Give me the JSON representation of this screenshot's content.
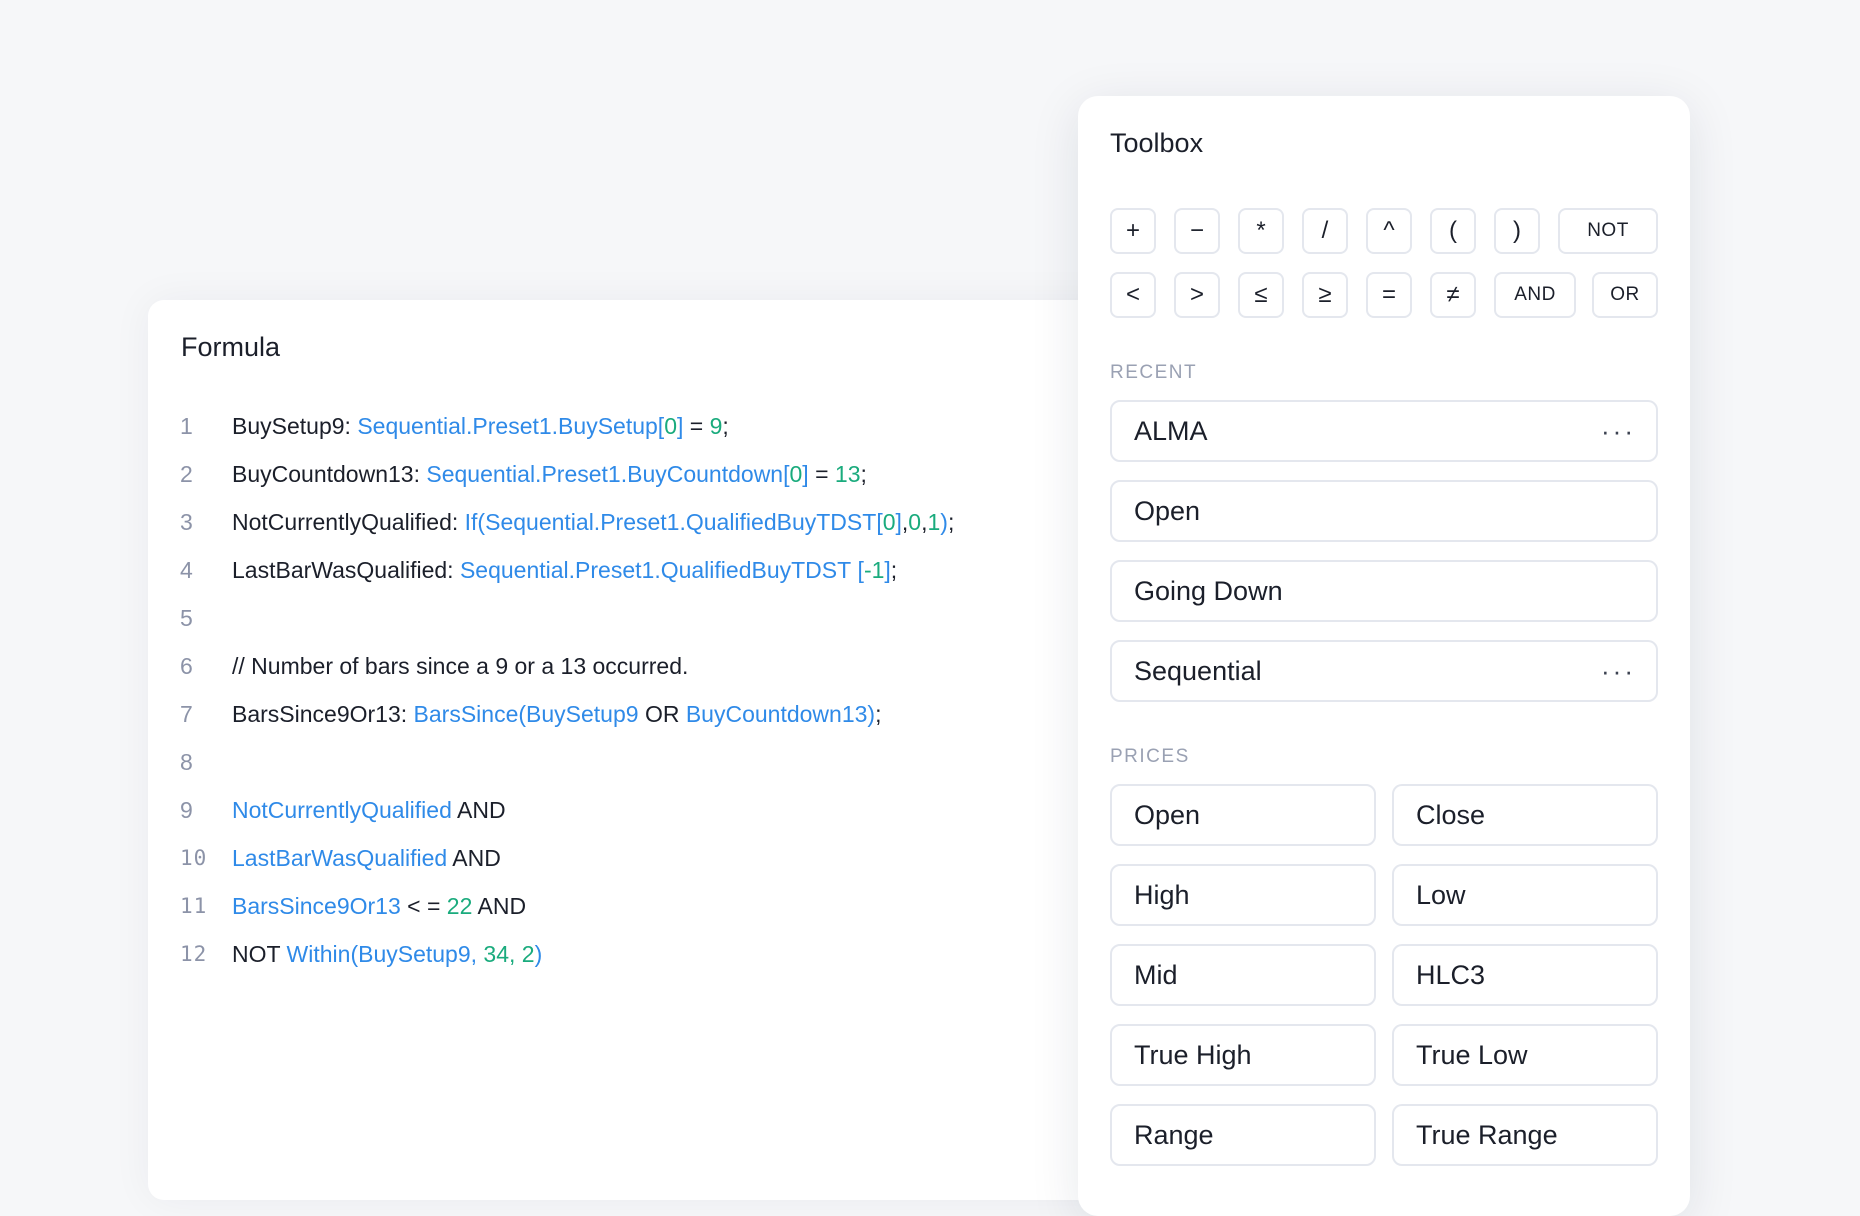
{
  "formula": {
    "title": "Formula",
    "lines": [
      {
        "num": "1",
        "tokens": [
          {
            "t": "BuySetup9: ",
            "c": "p"
          },
          {
            "t": "Sequential.Preset1.BuySetup",
            "c": "b"
          },
          {
            "t": "[",
            "c": "b"
          },
          {
            "t": "0",
            "c": "n"
          },
          {
            "t": "]",
            "c": "b"
          },
          {
            "t": " = ",
            "c": "p"
          },
          {
            "t": "9",
            "c": "n"
          },
          {
            "t": ";",
            "c": "p"
          }
        ]
      },
      {
        "num": "2",
        "tokens": [
          {
            "t": "BuyCountdown13: ",
            "c": "p"
          },
          {
            "t": "Sequential.Preset1.BuyCountdown",
            "c": "b"
          },
          {
            "t": "[",
            "c": "b"
          },
          {
            "t": "0",
            "c": "n"
          },
          {
            "t": "]",
            "c": "b"
          },
          {
            "t": " = ",
            "c": "p"
          },
          {
            "t": "13",
            "c": "n"
          },
          {
            "t": ";",
            "c": "p"
          }
        ]
      },
      {
        "num": "3",
        "tokens": [
          {
            "t": "NotCurrentlyQualified: ",
            "c": "p"
          },
          {
            "t": "If(",
            "c": "b"
          },
          {
            "t": "Sequential.Preset1.QualifiedBuyTDST",
            "c": "b"
          },
          {
            "t": "[",
            "c": "b"
          },
          {
            "t": "0",
            "c": "n"
          },
          {
            "t": "]",
            "c": "b"
          },
          {
            "t": ",",
            "c": "p"
          },
          {
            "t": "0",
            "c": "n"
          },
          {
            "t": ",",
            "c": "p"
          },
          {
            "t": "1",
            "c": "n"
          },
          {
            "t": ")",
            "c": "b"
          },
          {
            "t": ";",
            "c": "p"
          }
        ]
      },
      {
        "num": "4",
        "tokens": [
          {
            "t": "LastBarWasQualified: ",
            "c": "p"
          },
          {
            "t": "Sequential.Preset1.QualifiedBuyTDST",
            "c": "b"
          },
          {
            "t": " [",
            "c": "b"
          },
          {
            "t": "-1",
            "c": "n"
          },
          {
            "t": "]",
            "c": "b"
          },
          {
            "t": ";",
            "c": "p"
          }
        ]
      },
      {
        "num": "5",
        "tokens": []
      },
      {
        "num": "6",
        "tokens": [
          {
            "t": "// Number of bars since a 9 or a 13 occurred.",
            "c": "p"
          }
        ]
      },
      {
        "num": "7",
        "tokens": [
          {
            "t": "BarsSince9Or13: ",
            "c": "p"
          },
          {
            "t": "BarsSince",
            "c": "b"
          },
          {
            "t": "(",
            "c": "b"
          },
          {
            "t": "BuySetup9",
            "c": "b"
          },
          {
            "t": " OR ",
            "c": "p"
          },
          {
            "t": "BuyCountdown13",
            "c": "b"
          },
          {
            "t": ")",
            "c": "b"
          },
          {
            "t": ";",
            "c": "p"
          }
        ]
      },
      {
        "num": "8",
        "tokens": []
      },
      {
        "num": "9",
        "tokens": [
          {
            "t": "NotCurrentlyQualified",
            "c": "b"
          },
          {
            "t": " AND",
            "c": "p"
          }
        ]
      },
      {
        "num": "10",
        "tokens": [
          {
            "t": "LastBarWasQualified",
            "c": "b"
          },
          {
            "t": " AND",
            "c": "p"
          }
        ]
      },
      {
        "num": "11",
        "tokens": [
          {
            "t": "BarsSince9Or13",
            "c": "b"
          },
          {
            "t": " < = ",
            "c": "p"
          },
          {
            "t": "22",
            "c": "n"
          },
          {
            "t": " AND",
            "c": "p"
          }
        ]
      },
      {
        "num": "12",
        "tokens": [
          {
            "t": "NOT ",
            "c": "p"
          },
          {
            "t": "Within",
            "c": "b"
          },
          {
            "t": "(",
            "c": "b"
          },
          {
            "t": "BuySetup9, ",
            "c": "b"
          },
          {
            "t": "34, 2",
            "c": "n"
          },
          {
            "t": ")",
            "c": "b"
          }
        ]
      }
    ]
  },
  "toolbox": {
    "title": "Toolbox",
    "operators": [
      {
        "label": "+",
        "name": "plus-button"
      },
      {
        "label": "−",
        "name": "minus-button"
      },
      {
        "label": "*",
        "name": "multiply-button"
      },
      {
        "label": "/",
        "name": "divide-button"
      },
      {
        "label": "^",
        "name": "power-button"
      },
      {
        "label": "(",
        "name": "open-paren-button"
      },
      {
        "label": ")",
        "name": "close-paren-button"
      },
      {
        "label": "NOT",
        "name": "not-button"
      },
      {
        "label": "<",
        "name": "less-than-button"
      },
      {
        "label": ">",
        "name": "greater-than-button"
      },
      {
        "label": "≤",
        "name": "less-equal-button"
      },
      {
        "label": "≥",
        "name": "greater-equal-button"
      },
      {
        "label": "=",
        "name": "equals-button"
      },
      {
        "label": "≠",
        "name": "not-equal-button"
      },
      {
        "label": "AND",
        "name": "and-button"
      },
      {
        "label": "OR",
        "name": "or-button"
      }
    ],
    "recent_label": "RECENT",
    "recent": [
      {
        "label": "ALMA",
        "more": true,
        "more_label": "···"
      },
      {
        "label": "Open",
        "more": false
      },
      {
        "label": "Going Down",
        "more": false
      },
      {
        "label": "Sequential",
        "more": true,
        "more_label": "···"
      }
    ],
    "prices_label": "PRICES",
    "prices": [
      "Open",
      "Close",
      "High",
      "Low",
      "Mid",
      "HLC3",
      "True High",
      "True Low",
      "Range",
      "True Range"
    ]
  }
}
